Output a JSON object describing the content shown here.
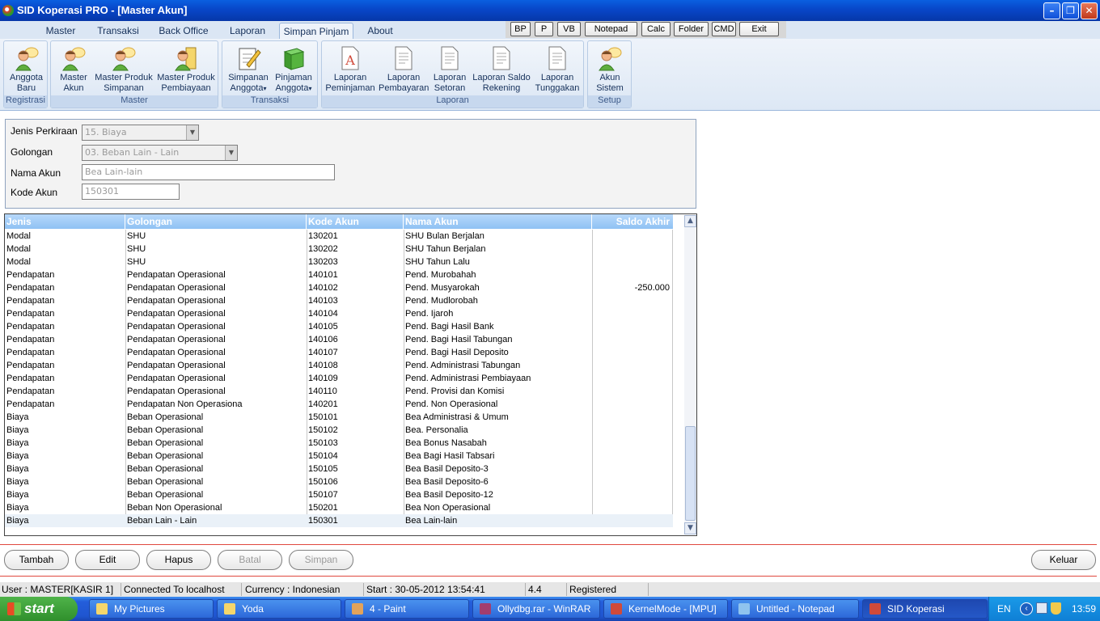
{
  "window": {
    "title": "SID Koperasi PRO - [Master Akun]"
  },
  "menu": {
    "tabs": [
      "Master",
      "Transaksi",
      "Back Office",
      "Laporan",
      "Simpan Pinjam",
      "About"
    ],
    "active": "Simpan Pinjam"
  },
  "quick": [
    "BP",
    "P",
    "VB",
    "Notepad",
    "Calc",
    "Folder",
    "CMD",
    "Exit"
  ],
  "ribbon": {
    "groups": [
      {
        "label": "Registrasi",
        "buttons": [
          {
            "l1": "Anggota",
            "l2": "Baru",
            "icon": "person-icon"
          }
        ]
      },
      {
        "label": "Master",
        "buttons": [
          {
            "l1": "Master",
            "l2": "Akun",
            "icon": "person-icon"
          },
          {
            "l1": "Master Produk",
            "l2": "Simpanan",
            "icon": "person-icon"
          },
          {
            "l1": "Master Produk",
            "l2": "Pembiayaan",
            "icon": "person-icon"
          }
        ]
      },
      {
        "label": "Transaksi",
        "buttons": [
          {
            "l1": "Simpanan",
            "l2": "Anggota",
            "icon": "notepad-icon",
            "dropdown": "▾"
          },
          {
            "l1": "Pinjaman",
            "l2": "Anggota",
            "icon": "book-icon",
            "dropdown": "▾"
          }
        ]
      },
      {
        "label": "Laporan",
        "buttons": [
          {
            "l1": "Laporan",
            "l2": "Peminjaman",
            "icon": "document-icon"
          },
          {
            "l1": "Laporan",
            "l2": "Pembayaran",
            "icon": "document-icon"
          },
          {
            "l1": "Laporan",
            "l2": "Setoran",
            "icon": "document-icon"
          },
          {
            "l1": "Laporan Saldo",
            "l2": "Rekening",
            "icon": "document-icon"
          },
          {
            "l1": "Laporan",
            "l2": "Tunggakan",
            "icon": "document-icon"
          }
        ]
      },
      {
        "label": "Setup",
        "buttons": [
          {
            "l1": "Akun",
            "l2": "Sistem",
            "icon": "person-icon"
          }
        ]
      }
    ]
  },
  "form": {
    "jenis_label": "Jenis Perkiraan",
    "jenis_value": "15. Biaya",
    "golongan_label": "Golongan",
    "golongan_value": "03. Beban Lain - Lain",
    "nama_label": "Nama Akun",
    "nama_value": "Bea Lain-lain",
    "kode_label": "Kode Akun",
    "kode_value": "150301"
  },
  "grid": {
    "columns": [
      "Jenis",
      "Golongan",
      "Kode Akun",
      "Nama Akun",
      "Saldo Akhir"
    ],
    "rows": [
      [
        "Modal",
        "SHU",
        "130201",
        "SHU Bulan Berjalan",
        ""
      ],
      [
        "Modal",
        "SHU",
        "130202",
        "SHU Tahun Berjalan",
        ""
      ],
      [
        "Modal",
        "SHU",
        "130203",
        "SHU Tahun Lalu",
        ""
      ],
      [
        "Pendapatan",
        "Pendapatan Operasional",
        "140101",
        "Pend. Murobahah",
        ""
      ],
      [
        "Pendapatan",
        "Pendapatan Operasional",
        "140102",
        "Pend. Musyarokah",
        "-250.000"
      ],
      [
        "Pendapatan",
        "Pendapatan Operasional",
        "140103",
        "Pend. Mudlorobah",
        ""
      ],
      [
        "Pendapatan",
        "Pendapatan Operasional",
        "140104",
        "Pend. Ijaroh",
        ""
      ],
      [
        "Pendapatan",
        "Pendapatan Operasional",
        "140105",
        "Pend. Bagi Hasil Bank",
        ""
      ],
      [
        "Pendapatan",
        "Pendapatan Operasional",
        "140106",
        "Pend. Bagi Hasil Tabungan",
        ""
      ],
      [
        "Pendapatan",
        "Pendapatan Operasional",
        "140107",
        "Pend. Bagi Hasil Deposito",
        ""
      ],
      [
        "Pendapatan",
        "Pendapatan Operasional",
        "140108",
        "Pend. Administrasi Tabungan",
        ""
      ],
      [
        "Pendapatan",
        "Pendapatan Operasional",
        "140109",
        "Pend. Administrasi Pembiayaan",
        ""
      ],
      [
        "Pendapatan",
        "Pendapatan Operasional",
        "140110",
        "Pend. Provisi dan Komisi",
        ""
      ],
      [
        "Pendapatan",
        "Pendapatan Non Operasiona",
        "140201",
        "Pend. Non Operasional",
        ""
      ],
      [
        "Biaya",
        "Beban Operasional",
        "150101",
        "Bea Administrasi & Umum",
        ""
      ],
      [
        "Biaya",
        "Beban Operasional",
        "150102",
        "Bea. Personalia",
        ""
      ],
      [
        "Biaya",
        "Beban Operasional",
        "150103",
        "Bea Bonus Nasabah",
        ""
      ],
      [
        "Biaya",
        "Beban Operasional",
        "150104",
        "Bea Bagi Hasil Tabsari",
        ""
      ],
      [
        "Biaya",
        "Beban Operasional",
        "150105",
        "Bea Basil Deposito-3",
        ""
      ],
      [
        "Biaya",
        "Beban Operasional",
        "150106",
        "Bea Basil Deposito-6",
        ""
      ],
      [
        "Biaya",
        "Beban Operasional",
        "150107",
        "Bea Basil Deposito-12",
        ""
      ],
      [
        "Biaya",
        "Beban Non Operasional",
        "150201",
        "Bea Non Operasional",
        ""
      ],
      [
        "Biaya",
        "Beban Lain - Lain",
        "150301",
        "Bea Lain-lain",
        ""
      ]
    ],
    "selected_row": 22
  },
  "actions": {
    "tambah": "Tambah",
    "edit": "Edit",
    "hapus": "Hapus",
    "batal": "Batal",
    "simpan": "Simpan",
    "keluar": "Keluar"
  },
  "status": {
    "user": "User : MASTER[KASIR 1]",
    "conn": "Connected To localhost",
    "currency": "Currency : Indonesian",
    "start": "Start  : 30-05-2012 13:54:41",
    "version": "4.4",
    "reg": "Registered"
  },
  "taskbar": {
    "start": "start",
    "items": [
      {
        "label": "My Pictures",
        "color": "#f5d66b"
      },
      {
        "label": "Yoda",
        "color": "#f5d66b"
      },
      {
        "label": "4 - Paint",
        "color": "#e3a35a"
      },
      {
        "label": "Ollydbg.rar - WinRAR",
        "color": "#a33d6e"
      },
      {
        "label": "KernelMode - [MPU]",
        "color": "#d04a3a"
      },
      {
        "label": "Untitled - Notepad",
        "color": "#8fc3ee"
      },
      {
        "label": "SID Koperasi",
        "color": "#d04a3a"
      }
    ],
    "lang": "EN",
    "clock": "13:59"
  }
}
